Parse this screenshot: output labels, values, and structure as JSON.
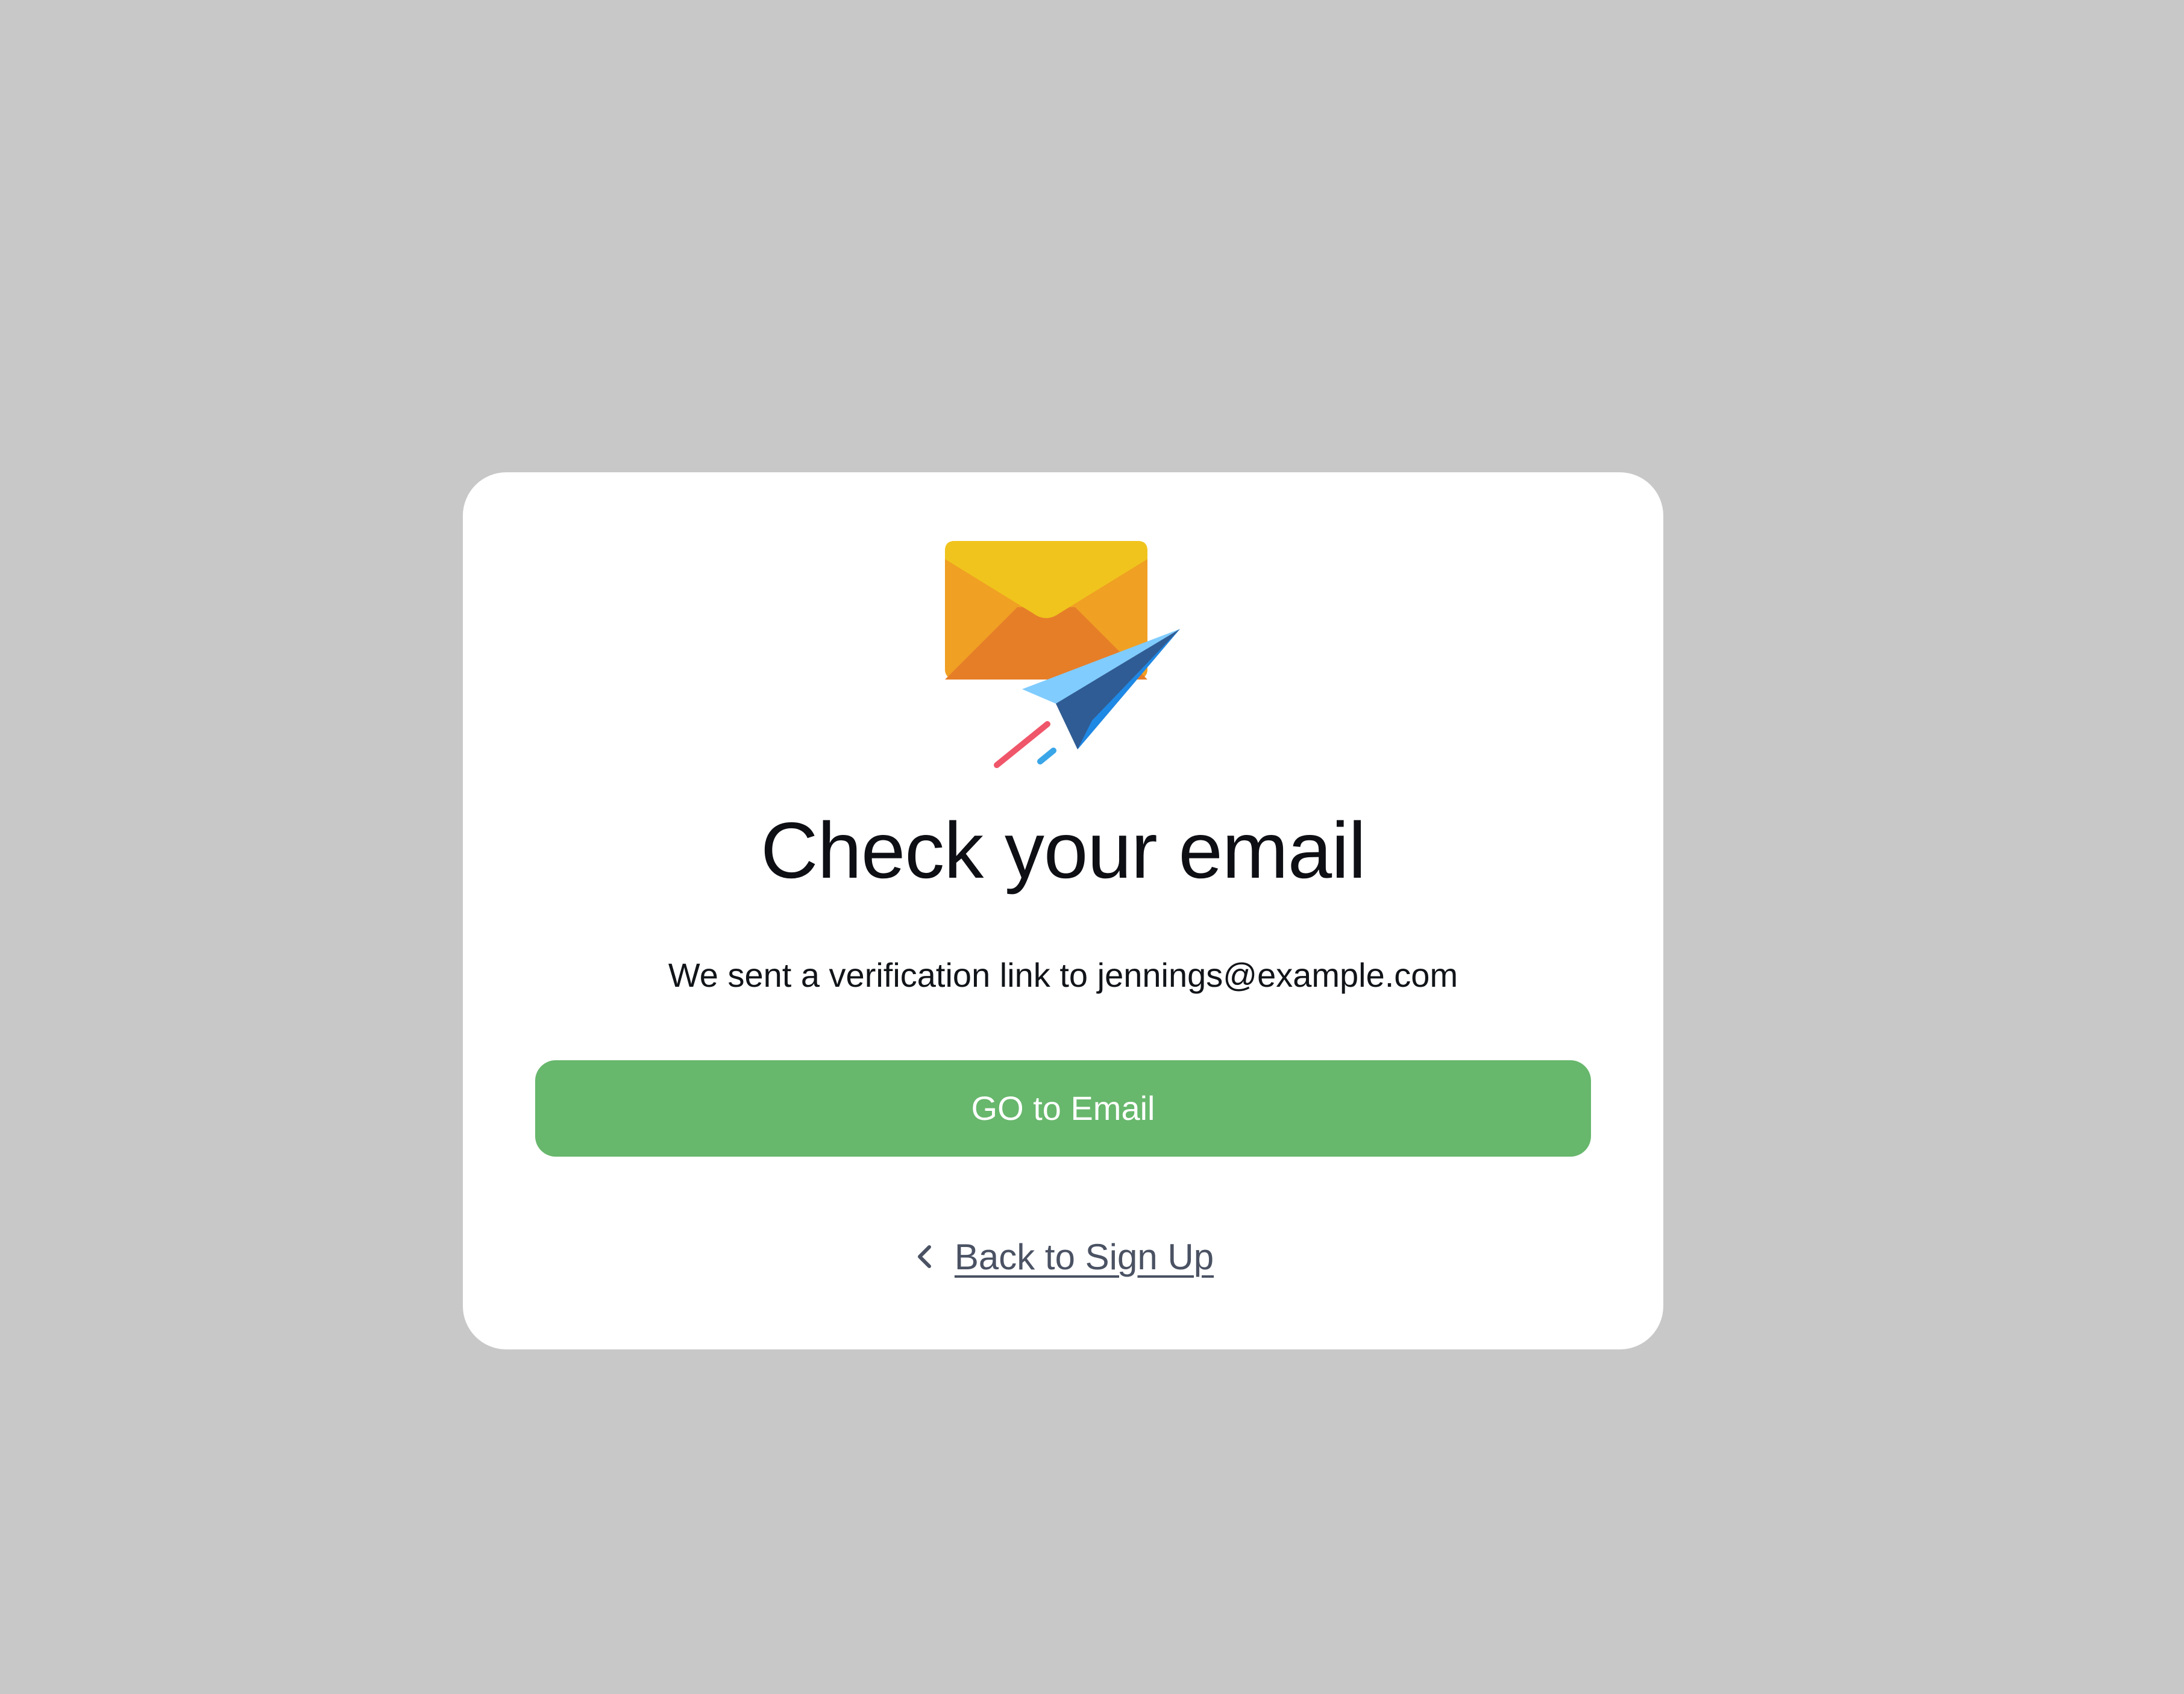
{
  "card": {
    "title": "Check your email",
    "subtitle": "We sent a verification link to jennings@example.com",
    "primary_button_label": "GO to Email",
    "back_link_label": "Back to Sign Up"
  },
  "icons": {
    "illustration": "envelope-paper-plane-icon",
    "back": "chevron-left-icon"
  },
  "colors": {
    "background": "#c8c8c8",
    "card": "#ffffff",
    "primary_button": "#67b76c",
    "link": "#4a5263"
  }
}
